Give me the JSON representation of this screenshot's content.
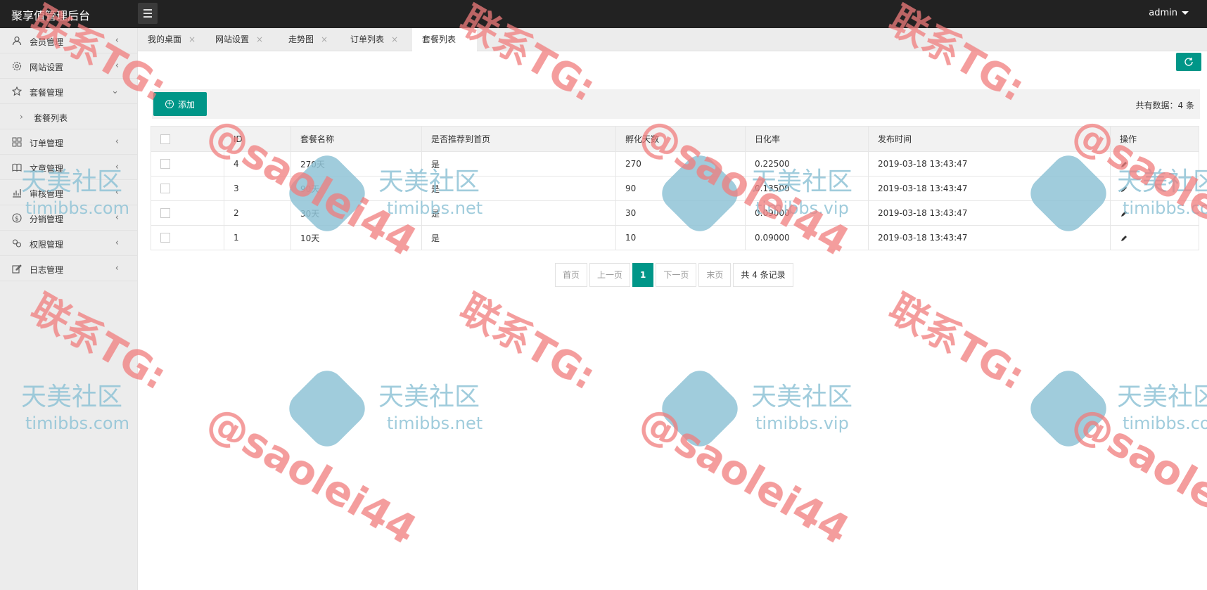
{
  "header": {
    "brand": "聚享值管理后台",
    "user": "admin"
  },
  "sidebar": {
    "items": [
      {
        "label": "会员管理",
        "icon": "user-icon"
      },
      {
        "label": "网站设置",
        "icon": "gear-icon"
      },
      {
        "label": "套餐管理",
        "icon": "star-icon"
      },
      {
        "label": "订单管理",
        "icon": "grid-icon"
      },
      {
        "label": "文章管理",
        "icon": "book-icon"
      },
      {
        "label": "审核管理",
        "icon": "chart-icon"
      },
      {
        "label": "分销管理",
        "icon": "dollar-icon"
      },
      {
        "label": "权限管理",
        "icon": "link-icon"
      },
      {
        "label": "日志管理",
        "icon": "edit-icon"
      }
    ],
    "sub_item": "套餐列表"
  },
  "tabs": [
    {
      "label": "我的桌面"
    },
    {
      "label": "网站设置"
    },
    {
      "label": "走势图"
    },
    {
      "label": "订单列表"
    },
    {
      "label": "套餐列表"
    }
  ],
  "toolbar": {
    "add_label": "添加",
    "total_label": "共有数据：4 条"
  },
  "table": {
    "headers": [
      "ID",
      "套餐名称",
      "是否推荐到首页",
      "孵化天数",
      "日化率",
      "发布时间",
      "操作"
    ],
    "rows": [
      {
        "id": "4",
        "name": "270天",
        "recommend": "是",
        "days": "270",
        "rate": "0.22500",
        "time": "2019-03-18 13:43:47"
      },
      {
        "id": "3",
        "name": "90天",
        "recommend": "是",
        "days": "90",
        "rate": "0.13500",
        "time": "2019-03-18 13:43:47"
      },
      {
        "id": "2",
        "name": "30天",
        "recommend": "是",
        "days": "30",
        "rate": "0.09000",
        "time": "2019-03-18 13:43:47"
      },
      {
        "id": "1",
        "name": "10天",
        "recommend": "是",
        "days": "10",
        "rate": "0.09000",
        "time": "2019-03-18 13:43:47"
      }
    ]
  },
  "pagination": {
    "first": "首页",
    "prev": "上一页",
    "current": "1",
    "next": "下一页",
    "last": "末页",
    "count": "共 4 条记录"
  },
  "watermark": {
    "tg_text": "联系TG:",
    "handle": "@saolei44",
    "brand_cn": "天美社区",
    "sites": [
      "timibbs.com",
      "timibbs.net",
      "timibbs.vip"
    ]
  },
  "colors": {
    "accent": "#009688",
    "header_bg": "#222222",
    "sidebar_bg": "#ececec",
    "watermark_red": "#f07c7c",
    "watermark_blue": "#8fc3d6"
  }
}
